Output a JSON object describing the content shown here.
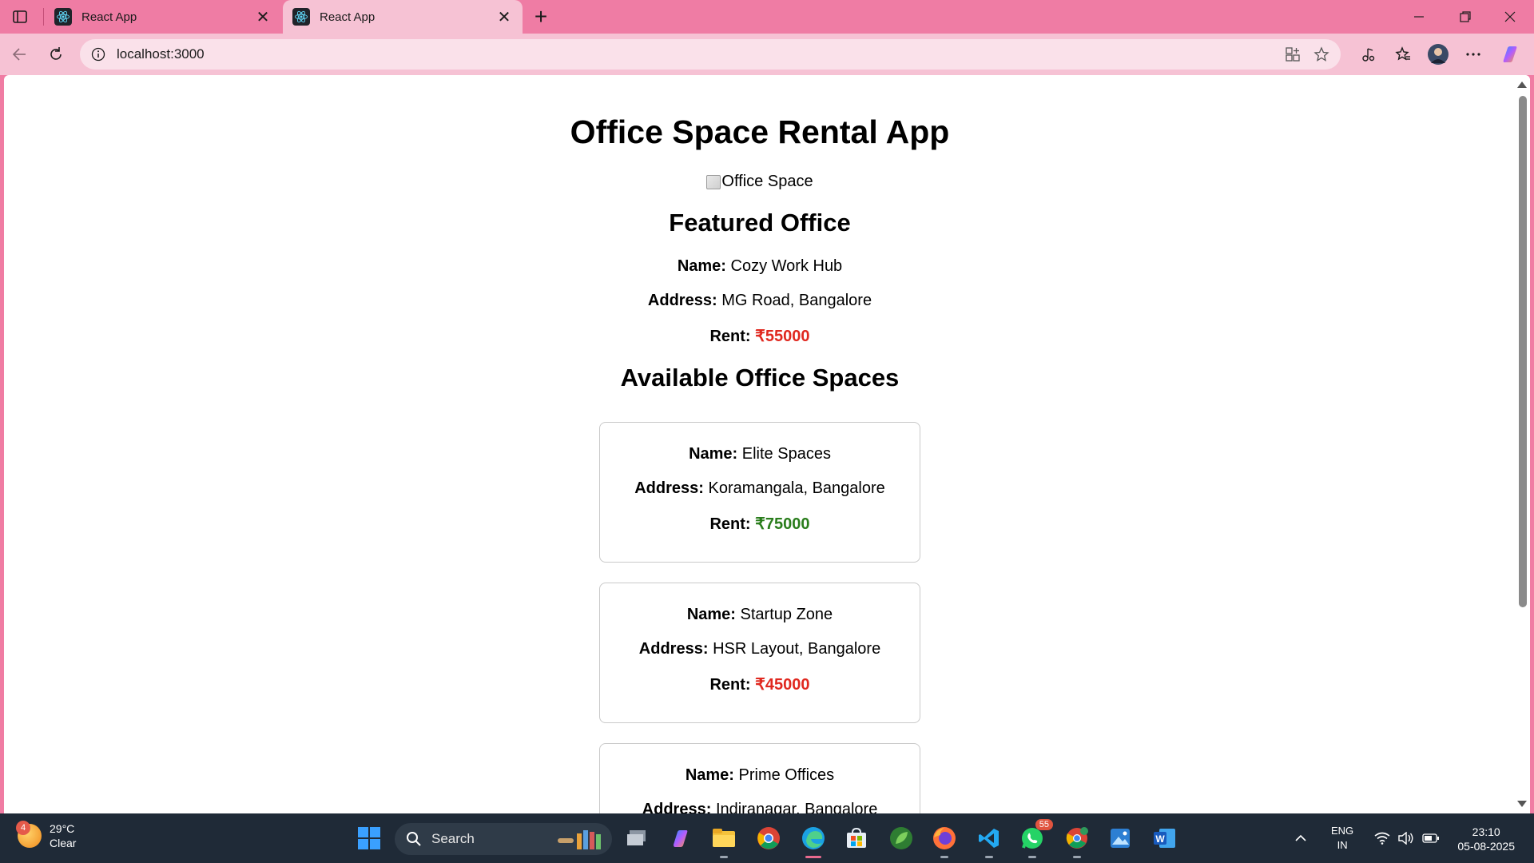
{
  "browser": {
    "tabs": [
      {
        "title": "React App",
        "active": false
      },
      {
        "title": "React App",
        "active": true
      }
    ],
    "address": "localhost:3000",
    "accent_color": "#ef7ca4"
  },
  "page": {
    "title": "Office Space Rental App",
    "image_alt": "Office Space",
    "featured_heading": "Featured Office",
    "featured": {
      "name_label": "Name:",
      "name": "Cozy Work Hub",
      "address_label": "Address:",
      "address": "MG Road, Bangalore",
      "rent_label": "Rent:",
      "rent": "₹55000",
      "rent_color": "#e0281f"
    },
    "list_heading": "Available Office Spaces",
    "offices": [
      {
        "name_label": "Name:",
        "name": "Elite Spaces",
        "address_label": "Address:",
        "address": "Koramangala, Bangalore",
        "rent_label": "Rent:",
        "rent": "₹75000",
        "rent_color": "#2a7d1c"
      },
      {
        "name_label": "Name:",
        "name": "Startup Zone",
        "address_label": "Address:",
        "address": "HSR Layout, Bangalore",
        "rent_label": "Rent:",
        "rent": "₹45000",
        "rent_color": "#e0281f"
      },
      {
        "name_label": "Name:",
        "name": "Prime Offices",
        "address_label": "Address:",
        "address": "Indiranagar, Bangalore"
      }
    ]
  },
  "taskbar": {
    "weather": {
      "temp": "29°C",
      "condition": "Clear",
      "badge": "4"
    },
    "search_label": "Search",
    "whatsapp_badge": "55",
    "lang": {
      "line1": "ENG",
      "line2": "IN"
    },
    "time": "23:10",
    "date": "05-08-2025"
  }
}
